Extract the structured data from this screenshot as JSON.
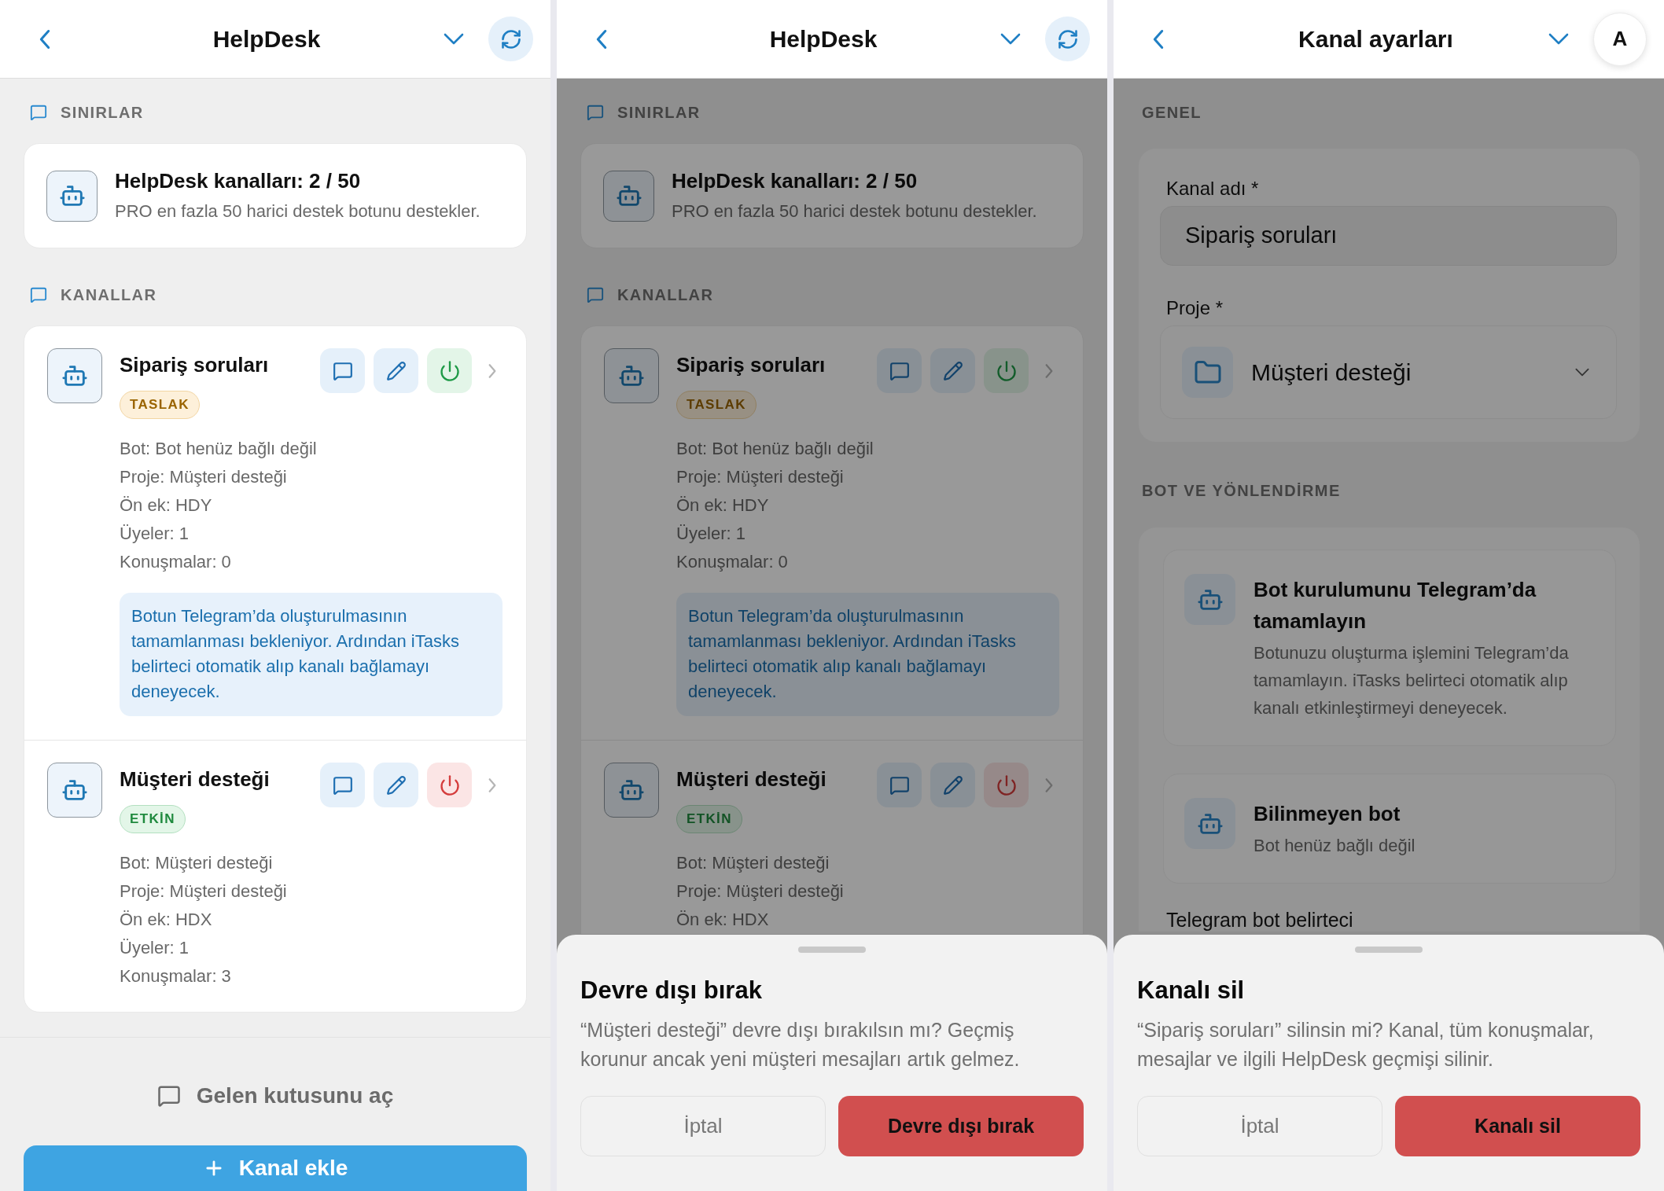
{
  "screens": [
    {
      "kind": "channel_list",
      "dimmed": false,
      "header": {
        "title": "HelpDesk",
        "trailing": {
          "kind": "refresh"
        }
      },
      "limits": {
        "label": "SINIRLAR",
        "title": "HelpDesk kanalları: 2 / 50",
        "subtitle": "PRO en fazla 50 harici destek botunu destekler."
      },
      "channels": {
        "label": "KANALLAR",
        "items": [
          {
            "name": "Sipariş soruları",
            "status": "TASLAK",
            "enabled": false,
            "details": [
              "Bot: Bot henüz bağlı değil",
              "Proje: Müşteri desteği",
              "Ön ek: HDY",
              "Üyeler: 1",
              "Konuşmalar: 0"
            ],
            "note": "Botun Telegram’da oluşturulmasının tamamlanması bekleniyor. Ardından iTasks belirteci otomatik alıp kanalı bağlamayı deneyecek."
          },
          {
            "name": "Müşteri desteği",
            "status": "ETKİN",
            "enabled": true,
            "details": [
              "Bot: Müşteri desteği",
              "Proje: Müşteri desteği",
              "Ön ek: HDX",
              "Üyeler: 1",
              "Konuşmalar: 3"
            ]
          }
        ]
      },
      "footer": {
        "inbox_button": "Gelen kutusunu aç",
        "add_button": "Kanal ekle"
      }
    },
    {
      "kind": "channel_list",
      "dimmed": true,
      "header": {
        "title": "HelpDesk",
        "trailing": {
          "kind": "refresh"
        }
      },
      "limits": {
        "label": "SINIRLAR",
        "title": "HelpDesk kanalları: 2 / 50",
        "subtitle": "PRO en fazla 50 harici destek botunu destekler."
      },
      "channels": {
        "label": "KANALLAR",
        "items": [
          {
            "name": "Sipariş soruları",
            "status": "TASLAK",
            "enabled": false,
            "details": [
              "Bot: Bot henüz bağlı değil",
              "Proje: Müşteri desteği",
              "Ön ek: HDY",
              "Üyeler: 1",
              "Konuşmalar: 0"
            ],
            "note": "Botun Telegram’da oluşturulmasının tamamlanması bekleniyor. Ardından iTasks belirteci otomatik alıp kanalı bağlamayı deneyecek."
          },
          {
            "name": "Müşteri desteği",
            "status": "ETKİN",
            "enabled": true,
            "details": [
              "Bot: Müşteri desteği",
              "Proje: Müşteri desteği",
              "Ön ek: HDX"
            ]
          }
        ]
      },
      "sheet": {
        "title": "Devre dışı bırak",
        "message": "“Müşteri desteği” devre dışı bırakılsın mı? Geçmiş korunur ancak yeni müşteri mesajları artık gelmez.",
        "cancel": "İptal",
        "confirm": "Devre dışı bırak"
      }
    },
    {
      "kind": "channel_settings",
      "dimmed": true,
      "header": {
        "title": "Kanal ayarları",
        "trailing": {
          "kind": "avatar",
          "label": "A"
        }
      },
      "general": {
        "label": "GENEL",
        "fields": [
          {
            "kind": "text",
            "label": "Kanal adı *",
            "value": "Sipariş soruları"
          },
          {
            "kind": "select",
            "label": "Proje *",
            "value": "Müşteri desteği"
          }
        ]
      },
      "bot_routing": {
        "label": "BOT VE YÖNLENDİRME",
        "bots": [
          {
            "title": "Bot kurulumunu Telegram’da tamamlayın",
            "description": "Botunuzu oluşturma işlemini Telegram’da tamamlayın. iTasks belirteci otomatik alıp kanalı etkinleştirmeyi deneyecek."
          },
          {
            "title": "Bilinmeyen bot",
            "description": "Bot henüz bağlı değil"
          }
        ],
        "field_label": "Telegram bot belirteci"
      },
      "sheet": {
        "title": "Kanalı sil",
        "message": "“Sipariş soruları” silinsin mi? Kanal, tüm konuşmalar, mesajlar ve ilgili HelpDesk geçmişi silinir.",
        "cancel": "İptal",
        "confirm": "Kanalı sil"
      }
    }
  ]
}
